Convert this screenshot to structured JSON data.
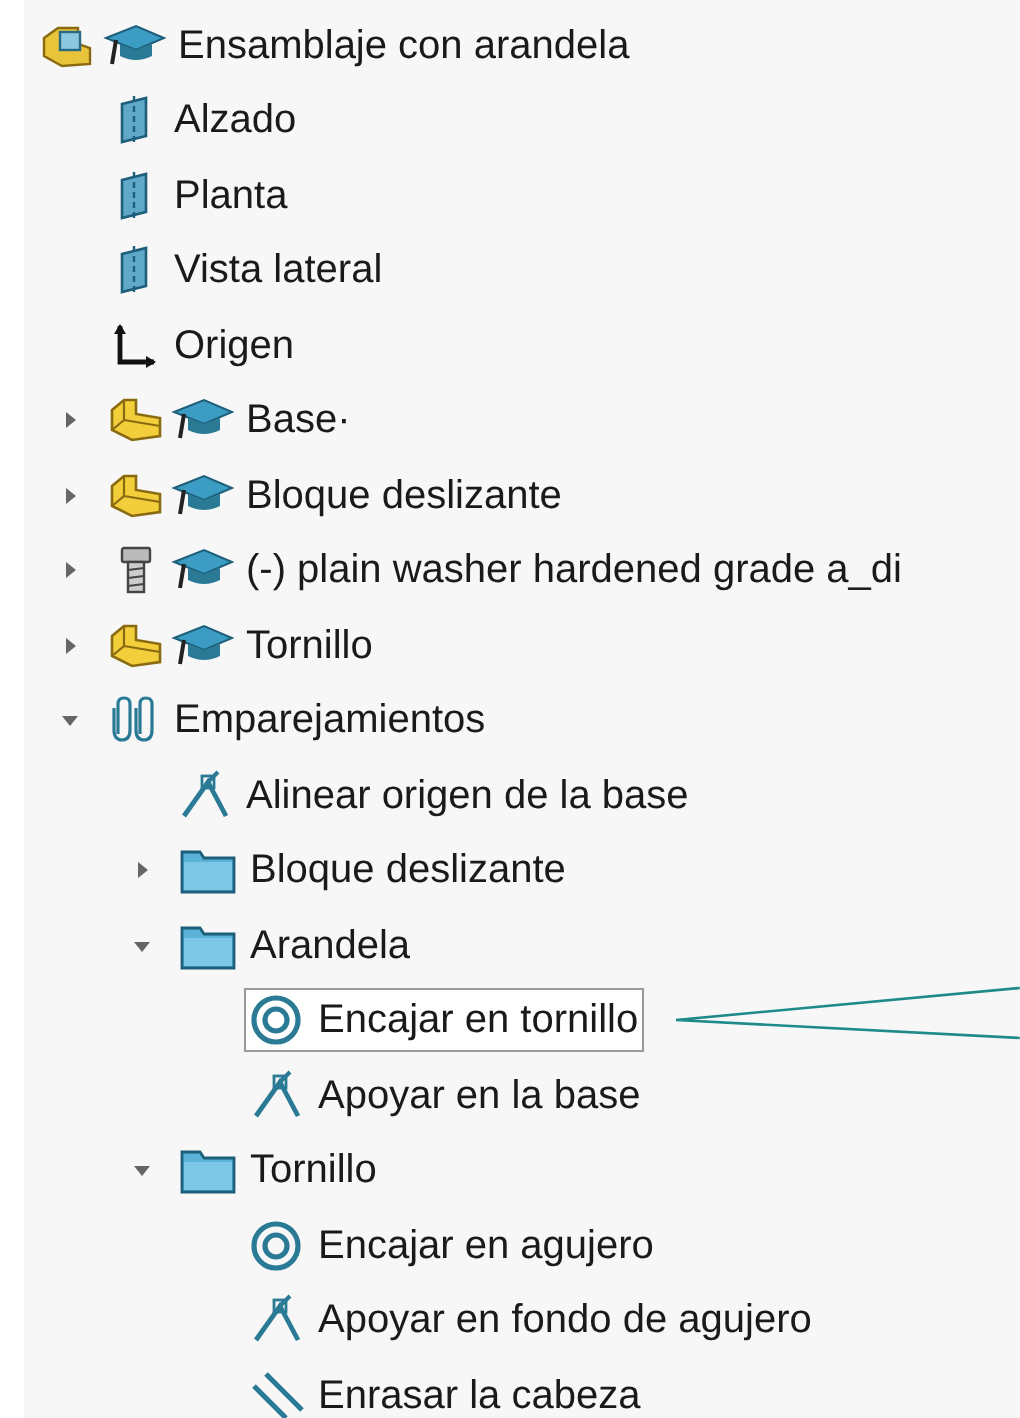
{
  "tree": [
    {
      "label": "Ensamblaje con arandela",
      "kind": "assembly",
      "children": [
        {
          "label": "Alzado",
          "kind": "plane"
        },
        {
          "label": "Planta",
          "kind": "plane"
        },
        {
          "label": "Vista lateral",
          "kind": "plane"
        },
        {
          "label": "Origen",
          "kind": "origin"
        },
        {
          "label": "Base·",
          "kind": "part",
          "expanded": false
        },
        {
          "label": "Bloque deslizante",
          "kind": "part",
          "expanded": false
        },
        {
          "label": "(-) plain washer hardened grade a_di",
          "kind": "fastener",
          "expanded": false
        },
        {
          "label": "Tornillo",
          "kind": "part",
          "expanded": false
        },
        {
          "label": "Emparejamientos",
          "kind": "mates",
          "expanded": true,
          "children": [
            {
              "label": "Alinear origen de la base",
              "kind": "coincident"
            },
            {
              "label": "Bloque deslizante",
              "kind": "folder",
              "expanded": false
            },
            {
              "label": "Arandela",
              "kind": "folder",
              "expanded": true,
              "children": [
                {
                  "label": "Encajar en tornillo",
                  "kind": "concentric",
                  "selected": true
                },
                {
                  "label": "Apoyar en la base",
                  "kind": "coincident",
                  "selected": false
                }
              ]
            },
            {
              "label": "Tornillo",
              "kind": "folder",
              "expanded": true,
              "children": [
                {
                  "label": "Encajar en agujero",
                  "kind": "concentric",
                  "selected": false
                },
                {
                  "label": "Apoyar en fondo de agujero",
                  "kind": "coincident",
                  "selected": false
                },
                {
                  "label": "Enrasar la cabeza",
                  "kind": "parallel",
                  "selected": false
                }
              ]
            }
          ]
        }
      ]
    }
  ]
}
